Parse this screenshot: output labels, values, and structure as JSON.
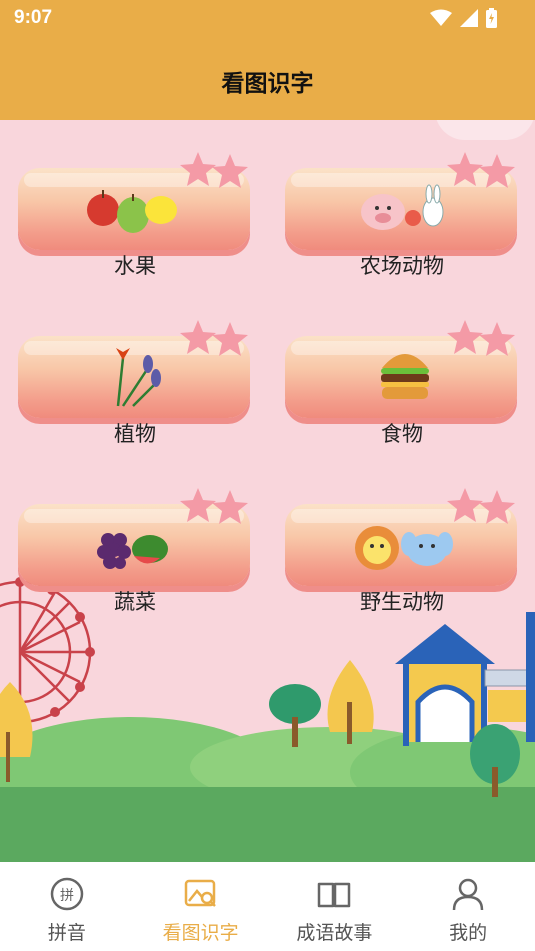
{
  "status_bar": {
    "time": "9:07"
  },
  "header": {
    "title": "看图识字"
  },
  "categories": [
    {
      "label": "水果",
      "image": "fruits-image"
    },
    {
      "label": "农场动物",
      "image": "farm-animals-image"
    },
    {
      "label": "植物",
      "image": "plants-image"
    },
    {
      "label": "食物",
      "image": "food-image"
    },
    {
      "label": "蔬菜",
      "image": "vegetables-image"
    },
    {
      "label": "野生动物",
      "image": "wild-animals-image"
    }
  ],
  "bottom_nav": [
    {
      "label": "拼音",
      "icon": "pinyin-icon",
      "active": false
    },
    {
      "label": "看图识字",
      "icon": "picture-search-icon",
      "active": true
    },
    {
      "label": "成语故事",
      "icon": "book-icon",
      "active": false
    },
    {
      "label": "我的",
      "icon": "person-icon",
      "active": false
    }
  ],
  "colors": {
    "accent": "#e9ad48",
    "background": "#f9d6dc",
    "grass": "#5ba95f"
  }
}
